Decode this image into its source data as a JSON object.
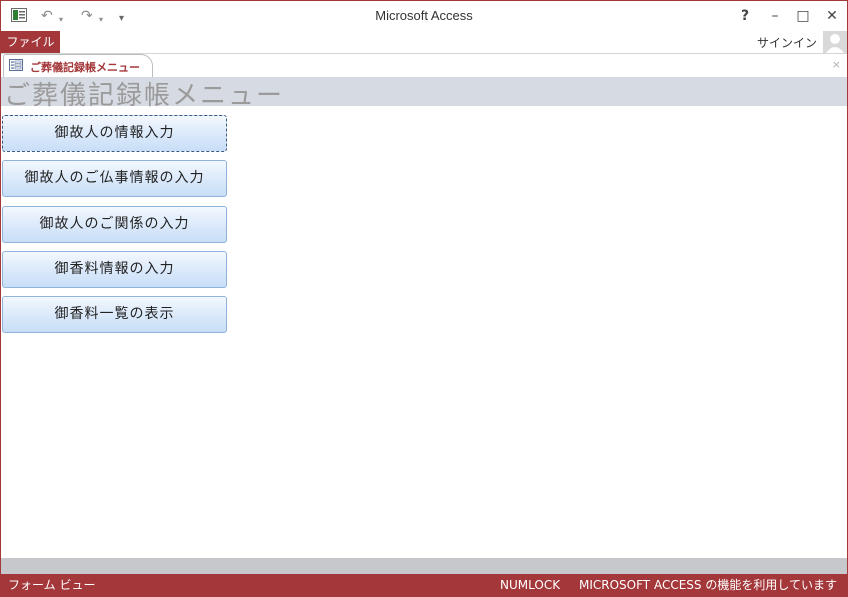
{
  "window": {
    "title": "Microsoft Access",
    "help_glyph": "?",
    "minimize_glyph": "–",
    "maximize_glyph": "□",
    "close_glyph": "✕",
    "accent_color": "#a4373a"
  },
  "qat": {
    "undo_glyph": "↶",
    "redo_glyph": "↷",
    "customize_glyph": "▾"
  },
  "ribbon": {
    "file_label": "ファイル",
    "signin_label": "サインイン"
  },
  "doc_tab": {
    "label": "ご葬儀記録帳メニュー",
    "close_glyph": "×"
  },
  "form": {
    "title": "ご葬儀記録帳メニュー",
    "buttons": [
      "御故人の情報入力",
      "御故人のご仏事情報の入力",
      "御故人のご関係の入力",
      "御香料情報の入力",
      "御香料一覧の表示"
    ]
  },
  "status": {
    "view": "フォーム ビュー",
    "numlock": "NUMLOCK",
    "message": "MICROSOFT ACCESS の機能を利用しています"
  }
}
